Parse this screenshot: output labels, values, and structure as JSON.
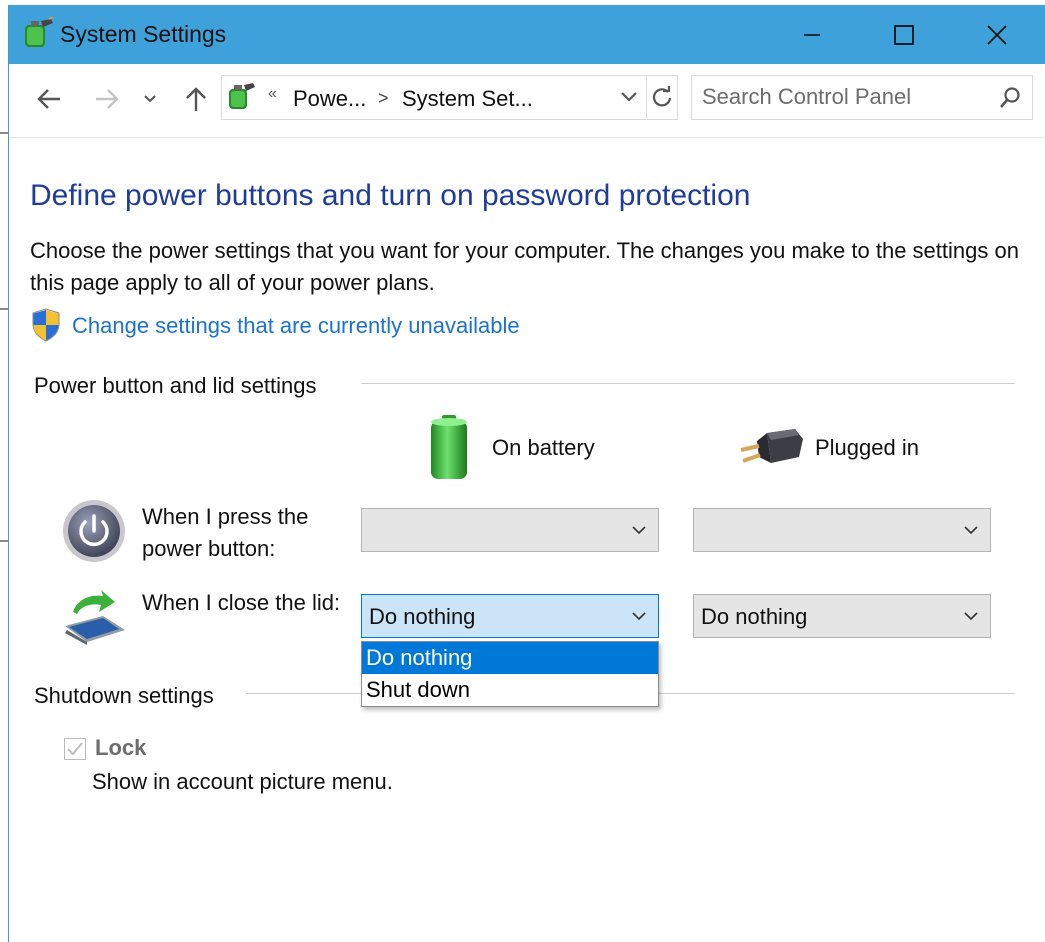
{
  "window": {
    "title": "System Settings",
    "controls": [
      "minimize",
      "maximize",
      "close"
    ]
  },
  "nav": {
    "back": "back-arrow",
    "forward": "forward-arrow",
    "recent": "chevron-down",
    "up": "up-arrow"
  },
  "address": {
    "overflow": "«",
    "crumbs": [
      "Powe...",
      "System Set..."
    ],
    "separator": ">"
  },
  "search": {
    "placeholder": "Search Control Panel"
  },
  "page": {
    "heading": "Define power buttons and turn on password protection",
    "description": "Choose the power settings that you want for your computer. The changes you make to the settings on this page apply to all of your power plans.",
    "change_link": "Change settings that are currently unavailable"
  },
  "power_section": {
    "title": "Power button and lid settings",
    "columns": [
      "On battery",
      "Plugged in"
    ],
    "rows": [
      {
        "label": "When I press the power button:",
        "on_battery": "",
        "plugged_in": ""
      },
      {
        "label": "When I close the lid:",
        "on_battery": "Do nothing",
        "plugged_in": "Do nothing"
      }
    ],
    "open_dropdown": {
      "options": [
        "Do nothing",
        "Shut down"
      ],
      "selected_index": 0
    }
  },
  "shutdown_section": {
    "title": "Shutdown settings",
    "lock": {
      "label": "Lock",
      "description": "Show in account picture menu.",
      "checked": true
    }
  },
  "colors": {
    "titlebar": "#3ea1d9",
    "heading": "#1e3d9a",
    "link": "#1a73d1",
    "selection": "#0078d7"
  }
}
